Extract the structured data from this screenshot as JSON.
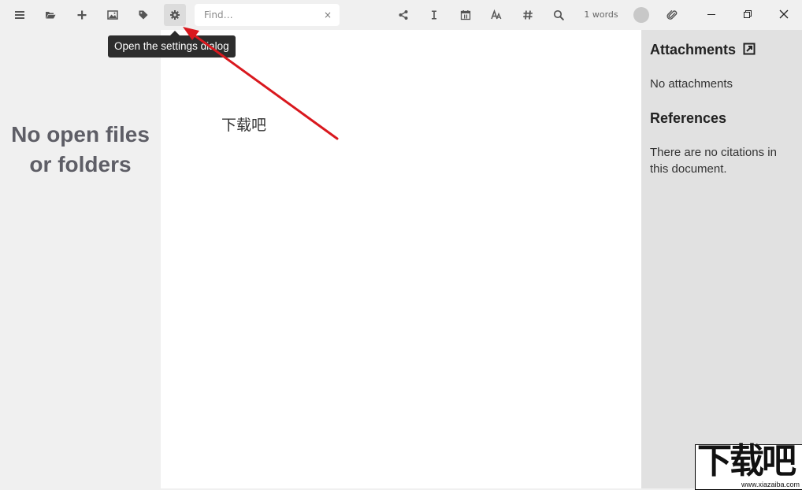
{
  "toolbar": {
    "buttons": [
      {
        "name": "menu-icon"
      },
      {
        "name": "folder-open-icon"
      },
      {
        "name": "plus-icon"
      },
      {
        "name": "image-icon"
      },
      {
        "name": "tag-icon"
      },
      {
        "name": "gear-icon"
      }
    ],
    "find_placeholder": "Find…",
    "find_value": "",
    "find_clear": "×",
    "right_buttons": [
      {
        "name": "share-icon"
      },
      {
        "name": "text-cursor-icon"
      },
      {
        "name": "calendar-icon"
      },
      {
        "name": "font-size-icon"
      },
      {
        "name": "hashtag-icon"
      },
      {
        "name": "search-icon"
      }
    ],
    "word_count": "1 words",
    "attachment_icon": "paperclip-icon"
  },
  "window_controls": {
    "minimize": "minimize-icon",
    "restore": "restore-icon",
    "close": "close-icon"
  },
  "tooltip": {
    "text": "Open the settings dialog"
  },
  "sidebar": {
    "empty_message": "No open files or folders"
  },
  "editor": {
    "content": "下载吧"
  },
  "right_panel": {
    "attachments_heading": "Attachments",
    "attachments_empty": "No attachments",
    "references_heading": "References",
    "references_empty": "There are no citations in this document."
  },
  "watermark": {
    "main": "下载吧",
    "sub": "www.xiazaiba.com"
  },
  "colors": {
    "toolbar_bg": "#f0f0f0",
    "editor_bg": "#ffffff",
    "right_panel_bg": "#e1e1e1",
    "tooltip_bg": "#2d2d2d",
    "annotation_arrow": "#d9181e"
  }
}
